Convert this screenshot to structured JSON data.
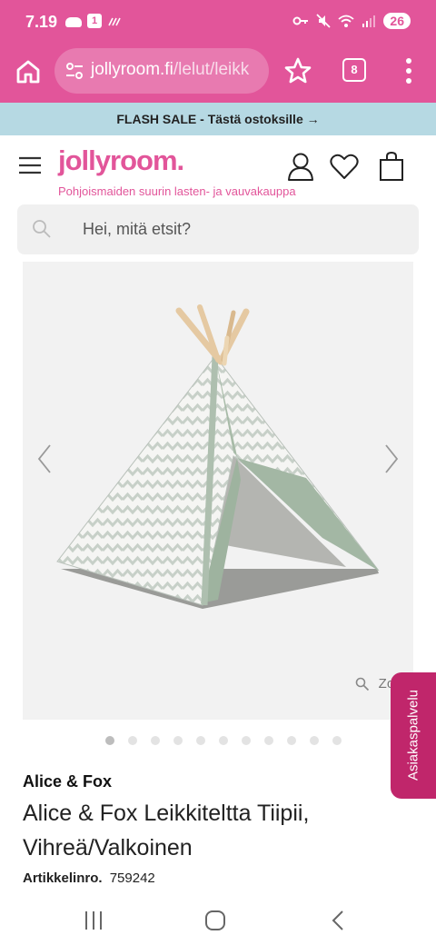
{
  "status_bar": {
    "time": "7.19",
    "notification_badge": "1",
    "battery": "26"
  },
  "browser": {
    "url_domain": "jollyroom.fi",
    "url_path": "/lelut/leikk",
    "tab_count": "8"
  },
  "banner": {
    "text": "FLASH SALE - Tästä ostoksille →"
  },
  "site": {
    "logo": "jollyroom.",
    "tagline": "Pohjoismaiden suurin lasten- ja vauvakauppa",
    "brand_color": "#e2559a"
  },
  "search": {
    "placeholder": "Hei, mitä etsit?"
  },
  "gallery": {
    "zoom_label": "Zoom",
    "image_count": 11,
    "active_index": 0
  },
  "customer_service": {
    "label": "Asiakaspalvelu"
  },
  "product": {
    "brand": "Alice & Fox",
    "title": "Alice & Fox Leikkiteltta Tiipii, Vihreä/Valkoinen",
    "article_label": "Artikkelinro.",
    "article_number": "759242"
  }
}
